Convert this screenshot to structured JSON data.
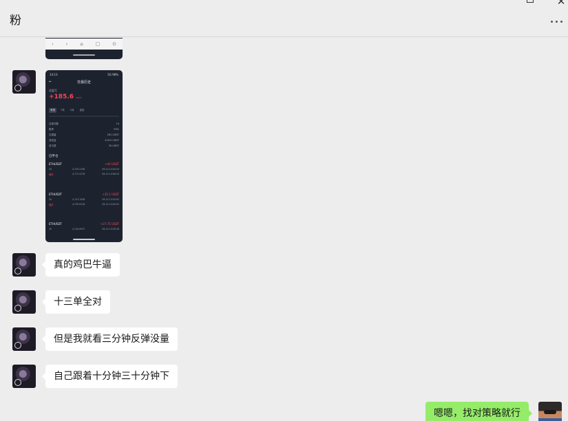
{
  "window": {
    "title": "粉",
    "minimize_icon": "minimize-icon",
    "maximize_icon": "maximize-icon",
    "close_label": "✕"
  },
  "screenshot": {
    "status_time": "14:13",
    "status_right": "5G 98%",
    "header": "交易历史",
    "profit_label": "总盈亏",
    "profit_value": "+185.6",
    "profit_unit": "USDT",
    "tabs": [
      "今天",
      "7天",
      "1月",
      "自定"
    ],
    "stats": [
      {
        "label": "交易次数",
        "value": "14"
      },
      {
        "label": "胜率",
        "value": "93%"
      },
      {
        "label": "交易量",
        "value": "261 USDT"
      },
      {
        "label": "总收益",
        "value": "216.0 USDT"
      },
      {
        "label": "总亏损",
        "value": "30 USDT"
      }
    ],
    "section_title": "已平仓",
    "trades": [
      {
        "symbol": "ETHUSDT",
        "pnl": "+40 USDT",
        "c1": "20",
        "c2": "4,720.2156",
        "c3": "09-14 14:04:15",
        "side": "做多",
        "c5": "4,717.4176",
        "c6": "09-14 14:06:15"
      },
      {
        "symbol": "ETHUSDT",
        "pnl": "+35.1 USDT",
        "c1": "20",
        "c2": "4,741.7426",
        "c3": "09-14 13:50:52",
        "side": "做多",
        "c5": "4,735.0216",
        "c6": "09-14 14:00:52"
      },
      {
        "symbol": "ETHUSDT",
        "pnl": "+27.75 USDT",
        "c1": "20",
        "c2": "4,744.0037",
        "c3": "09-14 13:35:16",
        "side": "",
        "c5": "",
        "c6": ""
      }
    ]
  },
  "messages": [
    {
      "sender": "contact",
      "text": "真的鸡巴牛逼"
    },
    {
      "sender": "contact",
      "text": "十三单全对"
    },
    {
      "sender": "contact",
      "text": "但是我就看三分钟反弹没量"
    },
    {
      "sender": "contact",
      "text": "自己跟着十分钟三十分钟下"
    },
    {
      "sender": "me",
      "text": "嗯嗯，找对策略就行"
    }
  ]
}
